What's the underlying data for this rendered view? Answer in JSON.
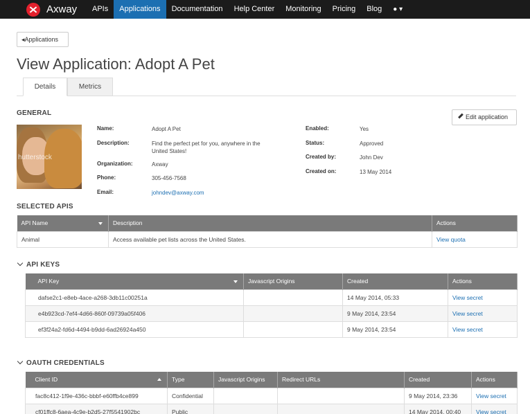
{
  "nav": {
    "brand": "Axway",
    "items": [
      "APIs",
      "Applications",
      "Documentation",
      "Help Center",
      "Monitoring",
      "Pricing",
      "Blog"
    ],
    "active": "Applications",
    "user_icon": "user-icon",
    "user_caret": "▾"
  },
  "back_button": "Applications",
  "page_title": "View Application: Adopt A Pet",
  "tabs": [
    "Details",
    "Metrics"
  ],
  "general": {
    "heading": "GENERAL",
    "edit_button": "Edit application",
    "image_watermark": "hutterstock",
    "left_fields": [
      {
        "label": "Name:",
        "value": "Adopt A Pet"
      },
      {
        "label": "Description:",
        "value": "Find the perfect pet for you, anywhere in the United States!"
      },
      {
        "label": "Organization:",
        "value": "Axway"
      },
      {
        "label": "Phone:",
        "value": "305-456-7568"
      },
      {
        "label": "Email:",
        "value": "johndev@axway.com"
      }
    ],
    "right_fields": [
      {
        "label": "Enabled:",
        "value": "Yes"
      },
      {
        "label": "Status:",
        "value": "Approved"
      },
      {
        "label": "Created by:",
        "value": "John Dev"
      },
      {
        "label": "Created on:",
        "value": "13 May 2014"
      }
    ]
  },
  "selected_apis": {
    "heading": "SELECTED APIS",
    "columns": [
      "API Name",
      "Description",
      "Actions"
    ],
    "rows": [
      {
        "name": "Animal",
        "description": "Access available pet lists across the United States.",
        "action": "View quota"
      }
    ]
  },
  "api_keys": {
    "heading": "API KEYS",
    "columns": [
      "API Key",
      "Javascript Origins",
      "Created",
      "Actions"
    ],
    "rows": [
      {
        "key": "dafse2c1-e8eb-4ace-a268-3db11c00251a",
        "origins": "",
        "created": "14 May 2014, 05:33",
        "action": "View secret"
      },
      {
        "key": "e4b923cd-7ef4-4d66-860f-09739a05f406",
        "origins": "",
        "created": "9 May 2014, 23:54",
        "action": "View secret"
      },
      {
        "key": "ef3f24a2-fd6d-4494-b9dd-6ad26924a450",
        "origins": "",
        "created": "9 May 2014, 23:54",
        "action": "View secret"
      }
    ]
  },
  "oauth": {
    "heading": "OAUTH CREDENTIALS",
    "columns": [
      "Client ID",
      "Type",
      "Javascript Origins",
      "Redirect URLs",
      "Created",
      "Actions"
    ],
    "rows": [
      {
        "client_id": "fac8c412-1f9e-436c-bbbf-e60ffb4ce899",
        "type": "Confidential",
        "origins": "",
        "redirect": "",
        "created": "9 May 2014, 23:36",
        "action": "View secret"
      },
      {
        "client_id": "cf01ffc8-6aea-4c9e-b2d5-27f5541902bc",
        "type": "Public",
        "origins": "",
        "redirect": "",
        "created": "14 May 2014, 00:40",
        "action": "View secret"
      }
    ]
  }
}
